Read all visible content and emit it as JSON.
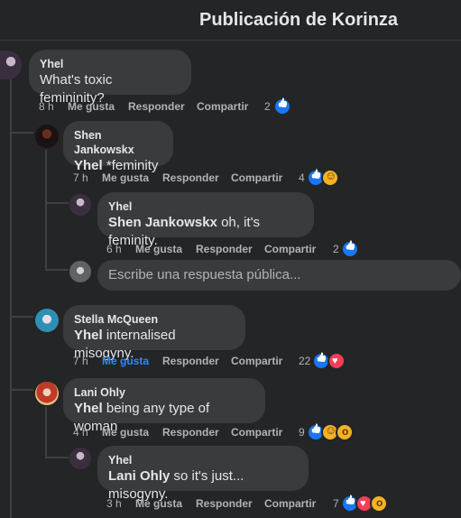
{
  "header": {
    "title": "Publicación de Korinza"
  },
  "actions": {
    "like": "Me gusta",
    "reply": "Responder",
    "share": "Compartir"
  },
  "reply_placeholder": "Escribe una respuesta pública...",
  "comments": [
    {
      "name": "Yhel",
      "text": "What's toxic femininity?",
      "time": "8 h",
      "reactions": "2"
    },
    {
      "name": "Shen Jankowskx",
      "mention": "Yhel",
      "text": "*feminity",
      "time": "7 h",
      "reactions": "4"
    },
    {
      "name": "Yhel",
      "mention": "Shen Jankowskx",
      "text": "oh, it's feminity.",
      "time": "6 h",
      "reactions": "2"
    },
    {
      "name": "Stella McQueen",
      "mention": "Yhel",
      "text": "internalised misogyny.",
      "time": "7 h",
      "reactions": "22"
    },
    {
      "name": "Lani Ohly",
      "mention": "Yhel",
      "text": "being any type of woman",
      "time": "4 h",
      "reactions": "9"
    },
    {
      "name": "Yhel",
      "mention": "Lani Ohly",
      "text": "so it's just... misogyny.",
      "time": "3 h",
      "reactions": "7"
    }
  ],
  "colors": {
    "background": "#242526",
    "bubble": "#3a3b3c",
    "liked": "#2d88ff",
    "like_reaction": "#1877f2",
    "love_reaction": "#f33e58",
    "haha_reaction": "#f7b125"
  }
}
